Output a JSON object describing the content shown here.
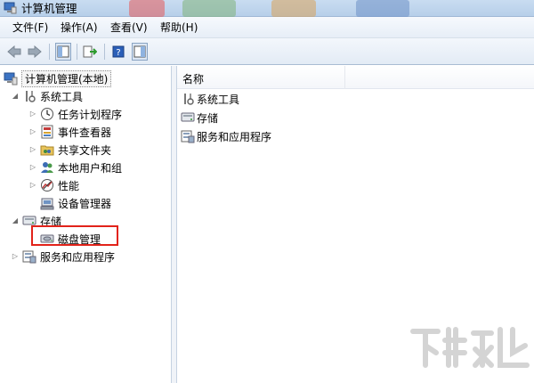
{
  "window": {
    "title": "计算机管理"
  },
  "menubar": [
    {
      "label": "文件(F)"
    },
    {
      "label": "操作(A)"
    },
    {
      "label": "查看(V)"
    },
    {
      "label": "帮助(H)"
    }
  ],
  "toolbar": {
    "buttons": [
      "back-icon",
      "forward-icon",
      "show-tree-icon",
      "export-list-icon",
      "help-icon",
      "show-action-pane-icon"
    ]
  },
  "tree": {
    "root": {
      "label": "计算机管理(本地)"
    },
    "system_tools": {
      "label": "系统工具",
      "children": [
        {
          "label": "任务计划程序",
          "icon": "clock-icon"
        },
        {
          "label": "事件查看器",
          "icon": "event-viewer-icon"
        },
        {
          "label": "共享文件夹",
          "icon": "shared-folder-icon"
        },
        {
          "label": "本地用户和组",
          "icon": "users-icon"
        },
        {
          "label": "性能",
          "icon": "performance-icon"
        },
        {
          "label": "设备管理器",
          "icon": "device-manager-icon"
        }
      ]
    },
    "storage": {
      "label": "存储",
      "children": [
        {
          "label": "磁盘管理",
          "icon": "disk-icon"
        }
      ]
    },
    "services": {
      "label": "服务和应用程序"
    }
  },
  "list": {
    "column_name": "名称",
    "items": [
      {
        "label": "系统工具",
        "icon": "tools-icon"
      },
      {
        "label": "存储",
        "icon": "storage-icon"
      },
      {
        "label": "服务和应用程序",
        "icon": "services-icon"
      }
    ]
  },
  "colors": {
    "highlight_box": "#e2231a",
    "title_bar": "#c9dcf1"
  }
}
